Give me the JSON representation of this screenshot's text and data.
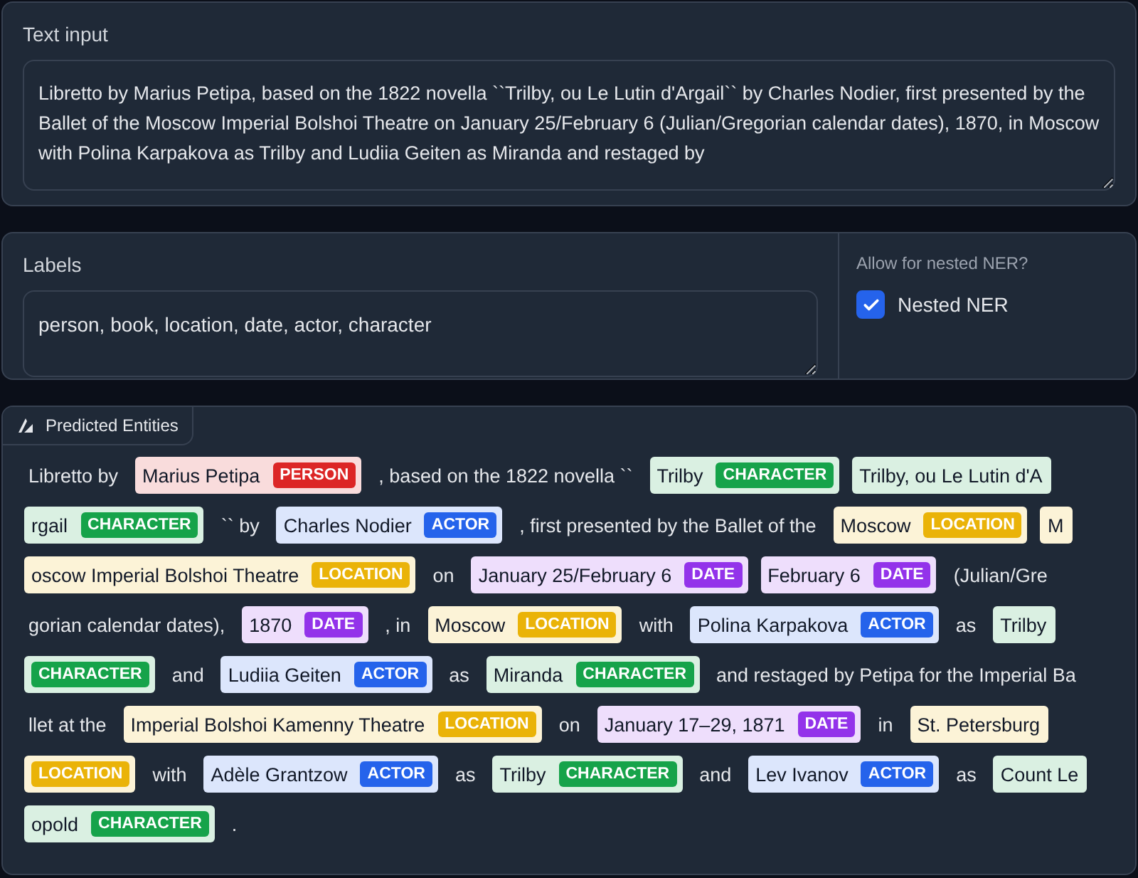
{
  "text_input": {
    "label": "Text input",
    "value": "Libretto by Marius Petipa, based on the 1822 novella ``Trilby, ou Le Lutin d'Argail`` by Charles Nodier, first presented by the Ballet of the Moscow Imperial Bolshoi Theatre on January 25/February 6 (Julian/Gregorian calendar dates), 1870, in Moscow with Polina Karpakova as Trilby and Ludiia Geiten as Miranda and restaged by"
  },
  "labels_input": {
    "label": "Labels",
    "value": "person, book, location, date, actor, character"
  },
  "nested": {
    "title": "Allow for nested NER?",
    "label": "Nested NER",
    "checked": true
  },
  "output": {
    "title": "Predicted Entities",
    "lines": [
      [
        {
          "kind": "plain",
          "text": "Libretto by"
        },
        {
          "kind": "entity",
          "text": "Marius Petipa",
          "label": "PERSON",
          "color": "#dc2626"
        },
        {
          "kind": "plain",
          "text": ", based on the 1822 novella ``"
        },
        {
          "kind": "entity",
          "text": "Trilby",
          "label": "CHARACTER",
          "color": "#16a34a"
        },
        {
          "kind": "entity",
          "text": "Trilby, ou Le Lutin d'A",
          "color": "#daf0e2"
        }
      ],
      [
        {
          "kind": "entity",
          "text": "rgail",
          "label": "CHARACTER",
          "color": "#16a34a"
        },
        {
          "kind": "plain",
          "text": "`` by"
        },
        {
          "kind": "entity",
          "text": "Charles Nodier",
          "label": "ACTOR",
          "color": "#2563eb"
        },
        {
          "kind": "plain",
          "text": ", first presented by the Ballet of the"
        },
        {
          "kind": "entity",
          "text": "Moscow",
          "label": "LOCATION",
          "color": "#eab308"
        },
        {
          "kind": "entity",
          "text": "M",
          "color": "#fcf3d7"
        }
      ],
      [
        {
          "kind": "entity",
          "text": "oscow Imperial Bolshoi Theatre",
          "label": "LOCATION",
          "color": "#eab308"
        },
        {
          "kind": "plain",
          "text": "on"
        },
        {
          "kind": "entity",
          "text": "January 25/February 6",
          "label": "DATE",
          "color": "#9333ea"
        },
        {
          "kind": "entity",
          "text": "February 6",
          "label": "DATE",
          "color": "#9333ea"
        },
        {
          "kind": "plain",
          "text": "(Julian/Gre"
        }
      ],
      [
        {
          "kind": "plain",
          "text": "gorian calendar dates),"
        },
        {
          "kind": "entity",
          "text": "1870",
          "label": "DATE",
          "color": "#9333ea"
        },
        {
          "kind": "plain",
          "text": ", in"
        },
        {
          "kind": "entity",
          "text": "Moscow",
          "label": "LOCATION",
          "color": "#eab308"
        },
        {
          "kind": "plain",
          "text": "with"
        },
        {
          "kind": "entity",
          "text": "Polina Karpakova",
          "label": "ACTOR",
          "color": "#2563eb"
        },
        {
          "kind": "plain",
          "text": "as"
        },
        {
          "kind": "entity",
          "text": "Trilby",
          "color": "#daf0e2"
        }
      ],
      [
        {
          "kind": "entity",
          "label": "CHARACTER",
          "color": "#16a34a"
        },
        {
          "kind": "plain",
          "text": "and"
        },
        {
          "kind": "entity",
          "text": "Ludiia Geiten",
          "label": "ACTOR",
          "color": "#2563eb"
        },
        {
          "kind": "plain",
          "text": "as"
        },
        {
          "kind": "entity",
          "text": "Miranda",
          "label": "CHARACTER",
          "color": "#16a34a"
        },
        {
          "kind": "plain",
          "text": "and restaged by Petipa for the Imperial Ba"
        }
      ],
      [
        {
          "kind": "plain",
          "text": "llet at the"
        },
        {
          "kind": "entity",
          "text": "Imperial Bolshoi Kamenny Theatre",
          "label": "LOCATION",
          "color": "#eab308"
        },
        {
          "kind": "plain",
          "text": "on"
        },
        {
          "kind": "entity",
          "text": "January 17–29, 1871",
          "label": "DATE",
          "color": "#9333ea"
        },
        {
          "kind": "plain",
          "text": "in"
        },
        {
          "kind": "entity",
          "text": "St. Petersburg",
          "color": "#fcf3d7"
        }
      ],
      [
        {
          "kind": "entity",
          "label": "LOCATION",
          "color": "#eab308"
        },
        {
          "kind": "plain",
          "text": "with"
        },
        {
          "kind": "entity",
          "text": "Adèle Grantzow",
          "label": "ACTOR",
          "color": "#2563eb"
        },
        {
          "kind": "plain",
          "text": "as"
        },
        {
          "kind": "entity",
          "text": "Trilby",
          "label": "CHARACTER",
          "color": "#16a34a"
        },
        {
          "kind": "plain",
          "text": "and"
        },
        {
          "kind": "entity",
          "text": "Lev Ivanov",
          "label": "ACTOR",
          "color": "#2563eb"
        },
        {
          "kind": "plain",
          "text": "as"
        },
        {
          "kind": "entity",
          "text": "Count Le",
          "color": "#daf0e2"
        }
      ],
      [
        {
          "kind": "entity",
          "text": "opold",
          "label": "CHARACTER",
          "color": "#16a34a"
        },
        {
          "kind": "plain",
          "text": "."
        }
      ]
    ]
  }
}
